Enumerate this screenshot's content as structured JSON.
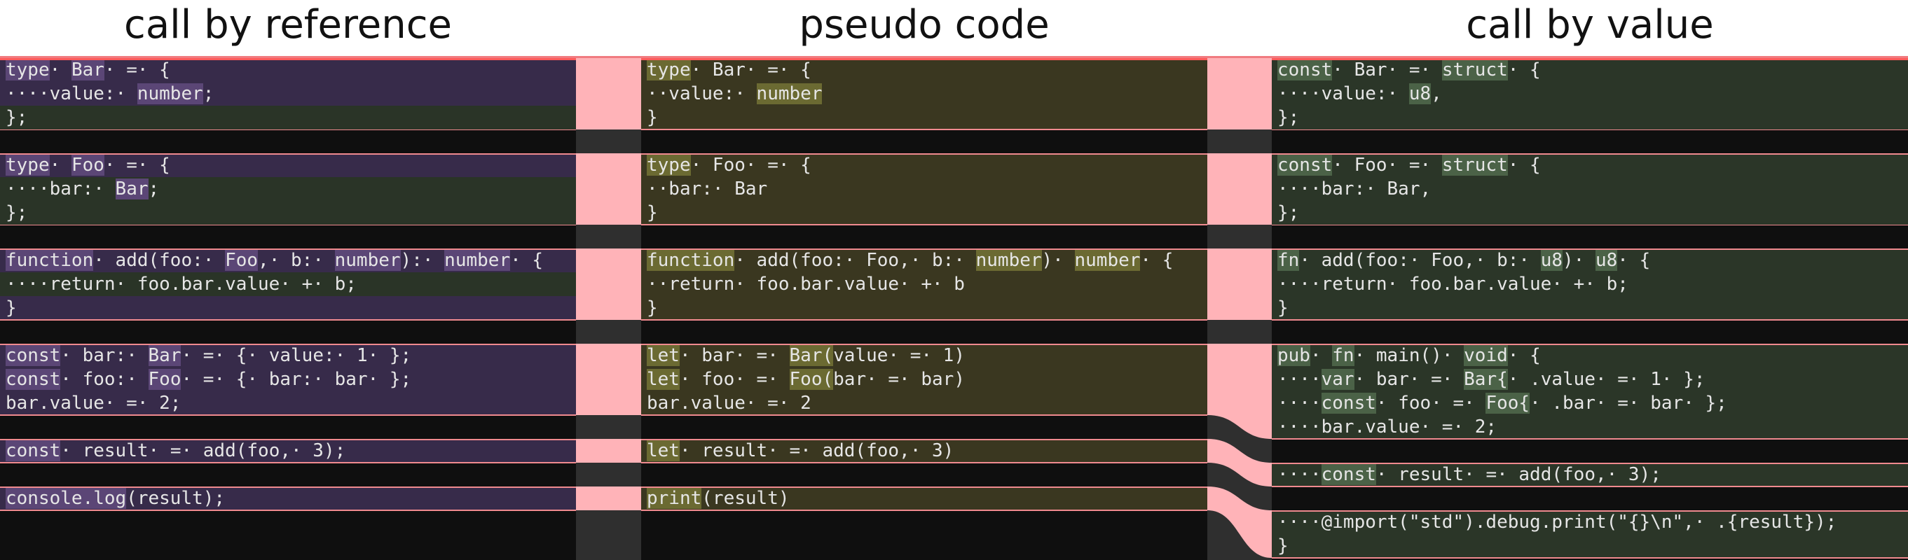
{
  "headings": {
    "left": "call by reference",
    "middle": "pseudo code",
    "right": "call by value"
  },
  "colors": {
    "left_block": "#372b4a",
    "middle_block": "#3a3720",
    "right_block": "#2b3628",
    "gutter_fill": "#ffb3b8",
    "gutter_mod": "#c9c9c9",
    "separator": "#f08a8f",
    "changed_separator": "#ff5b5b",
    "editor_bg": "#0f0f0f",
    "gutter_bg": "#2f2f2f"
  },
  "left": {
    "lines": [
      "type· Bar· =· {",
      "····value:· number;",
      "};",
      "",
      "type· Foo· =· {",
      "····bar:· Bar;",
      "};",
      "",
      "function· add(foo:· Foo,· b:· number):· number· {",
      "····return· foo.bar.value· +· b;",
      "}",
      "",
      "const· bar:· Bar· =· {· value:· 1· };",
      "const· foo:· Foo· =· {· bar:· bar· };",
      "bar.value· =· 2;",
      "",
      "const· result· =· add(foo,· 3);",
      "",
      "console.log(result);"
    ]
  },
  "middle": {
    "lines": [
      "type· Bar· =· {",
      "··value:· number",
      "}",
      "",
      "type· Foo· =· {",
      "··bar:· Bar",
      "}",
      "",
      "function· add(foo:· Foo,· b:· number)· number· {",
      "··return· foo.bar.value· +· b",
      "}",
      "",
      "let· bar· =· Bar(value· =· 1)",
      "let· foo· =· Foo(bar· =· bar)",
      "bar.value· =· 2",
      "",
      "let· result· =· add(foo,· 3)",
      "",
      "print(result)"
    ]
  },
  "right": {
    "lines": [
      "const· Bar· =· struct· {",
      "····value:· u8,",
      "};",
      "",
      "const· Foo· =· struct· {",
      "····bar:· Bar,",
      "};",
      "",
      "fn· add(foo:· Foo,· b:· u8)· u8· {",
      "····return· foo.bar.value· +· b;",
      "}",
      "",
      "pub· fn· main()· void· {",
      "····var· bar· =· Bar{· .value· =· 1· };",
      "····const· foo· =· Foo{· .bar· =· bar· };",
      "····bar.value· =· 2;",
      "",
      "····const· result· =· add(foo,· 3);",
      "",
      "····@import(\"std\").debug.print(\"{}\\n\",· .{result});",
      "}"
    ]
  }
}
